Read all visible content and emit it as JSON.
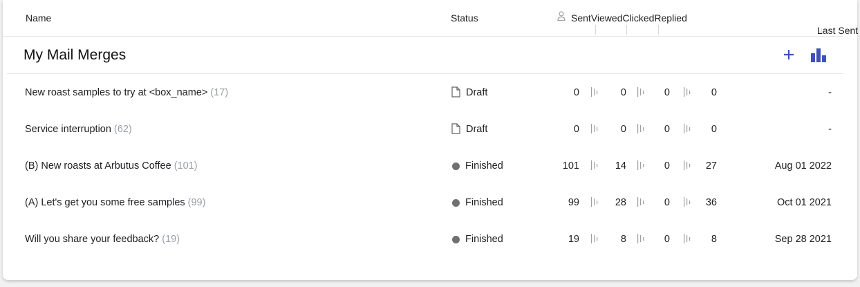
{
  "header": {
    "name_label": "Name",
    "status_label": "Status",
    "sent_label": "Sent",
    "viewed_label": "Viewed",
    "clicked_label": "Clicked",
    "replied_label": "Replied",
    "last_sent_label": "Last Sent",
    "sort_arrow": "↓"
  },
  "section": {
    "title": "My Mail Merges",
    "accent_color": "#3f51b5"
  },
  "rows": [
    {
      "name": "New roast samples to try at <box_name>",
      "count": "(17)",
      "status": "Draft",
      "status_icon": "document-icon",
      "sent": "0",
      "viewed": "0",
      "clicked": "0",
      "replied": "0",
      "last_sent": "-"
    },
    {
      "name": "Service interruption",
      "count": "(62)",
      "status": "Draft",
      "status_icon": "document-icon",
      "sent": "0",
      "viewed": "0",
      "clicked": "0",
      "replied": "0",
      "last_sent": "-"
    },
    {
      "name": "(B) New roasts at Arbutus Coffee",
      "count": "(101)",
      "status": "Finished",
      "status_icon": "dot-icon",
      "sent": "101",
      "viewed": "14",
      "clicked": "0",
      "replied": "27",
      "last_sent": "Aug 01 2022"
    },
    {
      "name": "(A) Let's get you some free samples",
      "count": "(99)",
      "status": "Finished",
      "status_icon": "dot-icon",
      "sent": "99",
      "viewed": "28",
      "clicked": "0",
      "replied": "36",
      "last_sent": "Oct 01 2021"
    },
    {
      "name": "Will you share your feedback?",
      "count": "(19)",
      "status": "Finished",
      "status_icon": "dot-icon",
      "sent": "19",
      "viewed": "8",
      "clicked": "0",
      "replied": "8",
      "last_sent": "Sep 28 2021"
    }
  ]
}
